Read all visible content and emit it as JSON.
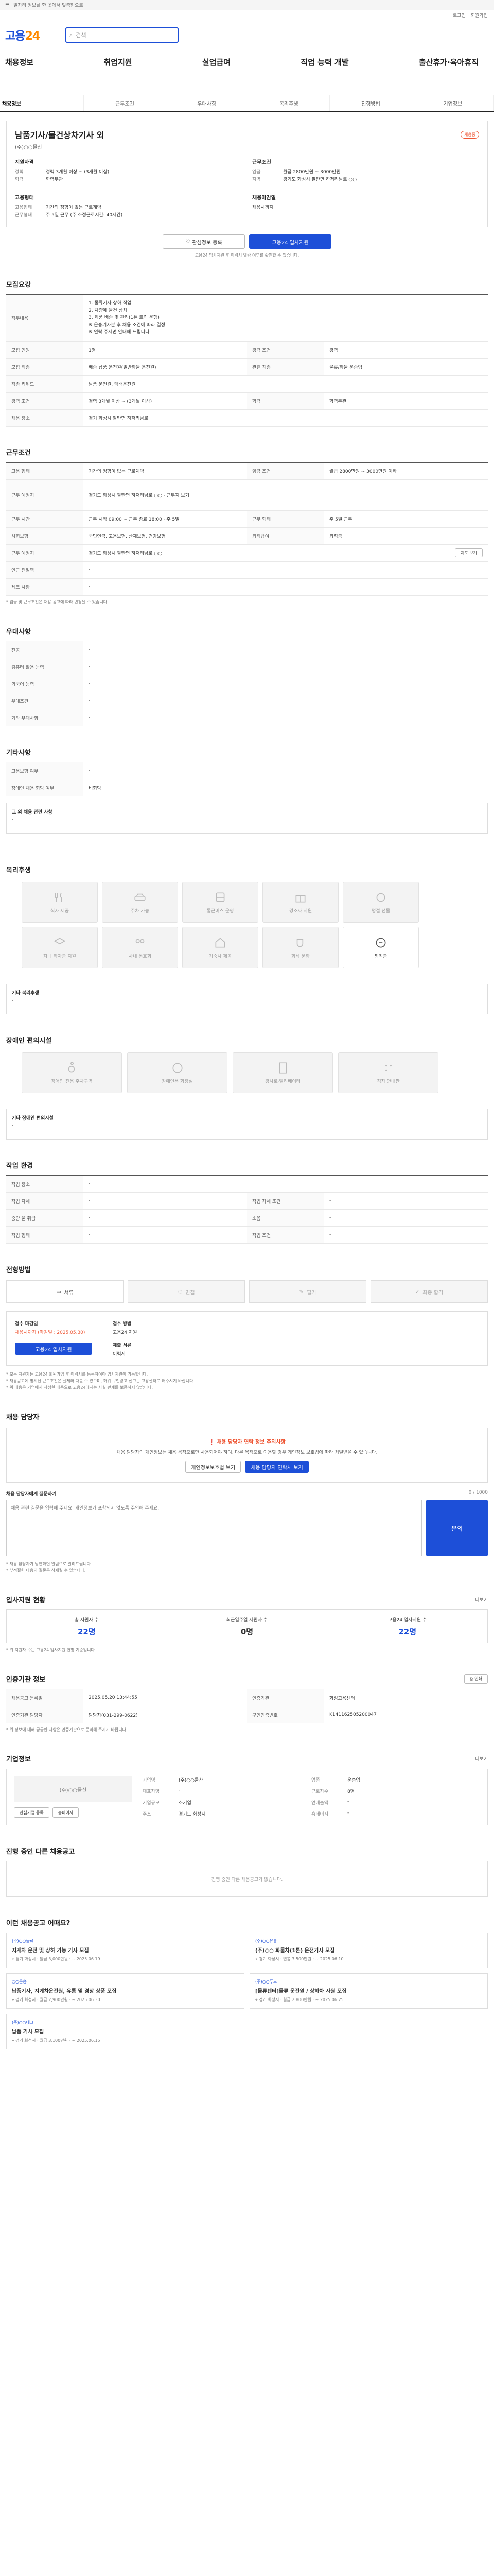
{
  "topbar": {
    "notice": "일자리 정보를 한 곳에서 맞춤형으로"
  },
  "util": {
    "login": "로그인",
    "join": "회원가입"
  },
  "header": {
    "logo_a": "고용",
    "logo_b": "24",
    "search_placeholder": "검색"
  },
  "gnb": [
    "채용정보",
    "취업지원",
    "실업급여",
    "직업 능력 개발",
    "출산휴가·육아휴직"
  ],
  "tabs": [
    "채용정보",
    "근무조건",
    "우대사항",
    "복리후생",
    "전형방법",
    "기업정보"
  ],
  "job": {
    "title": "남품기사/물건상차기사 외",
    "badge": "채용중",
    "company": "(주)○○물산",
    "req_title": "지원자격",
    "req": [
      {
        "k": "경력",
        "v": "경력 3개월 이상 ~ (3개월 이상)"
      },
      {
        "k": "학력",
        "v": "학력무관"
      }
    ],
    "cond_title": "근무조건",
    "cond": [
      {
        "k": "임금",
        "v": "월급 2800만원 ~ 3000만원"
      },
      {
        "k": "지역",
        "v": "경기도 화성시 팔탄면 하저리남로 ○○"
      }
    ],
    "type_title": "고용형태",
    "type": [
      {
        "k": "고용형태",
        "v": "기간의 정함이 없는 근로계약"
      },
      {
        "k": "근무형태",
        "v": "주 5일 근무 (주 소정근로시간: 40시간)"
      }
    ],
    "deadline_title": "채용마감일",
    "deadline": "채용시까지",
    "scrap_btn": "관심정보 등록",
    "apply_btn": "고용24 입사지원",
    "apply_note": "고용24 입사지원 후 이력서 열람 여부를 확인할 수 있습니다."
  },
  "recruit": {
    "h": "모집요강",
    "duty_k": "직무내용",
    "duties": [
      "1. 물류기사 상하 작업",
      "2. 차량에 물건 상차",
      "3. 제품 배송 및 관리(1톤 트럭 운행)",
      "",
      "※ 운송기사분 후 채용 조건에 따라 결정",
      "※ 연락 주시면 안내해 드립니다"
    ],
    "rows": [
      {
        "k": "모집 인원",
        "v": "1명",
        "k2": "경력 조건",
        "v2": "경력"
      },
      {
        "k": "모집 직종",
        "v": "배송 납품 운전원(일반화물 운전원)",
        "k2": "관련 직종",
        "v2": "물류/화물 운송업"
      },
      {
        "k": "직종 키워드",
        "v": "남품 운전원, 택배운전원",
        "k2": "",
        "v2": ""
      },
      {
        "k": "경력 조건",
        "v": "경력 3개월 이상 ~ (3개월 이상)",
        "k2": "학력",
        "v2": "학력무관"
      },
      {
        "k": "채용 장소",
        "v": "경기 화성시 팔탄면 하저리남로",
        "k2": "",
        "v2": ""
      }
    ]
  },
  "work": {
    "h": "근무조건",
    "rows": [
      {
        "k": "고용 형태",
        "v": "기간의 정함이 없는 근로계약",
        "k2": "임금 조건",
        "v2": "월급 2800만원 ~ 3000만원 이하"
      },
      {
        "k": "근무 예정지",
        "v": "경기도 화성시 팔탄면 하저리남로 ○○  · 근무지 보기",
        "k2": "",
        "v2": ""
      },
      {
        "k": "근무 시간",
        "v": "근무 시작 09:00 ~ 근무 종료 18:00 · 주 5일",
        "k2": "근무 형태",
        "v2": "주 5일 근무"
      },
      {
        "k": "사회보험",
        "v": "국민연금, 고용보험, 산재보험, 건강보험",
        "k2": "퇴직급여",
        "v2": "퇴직금"
      },
      {
        "k": "근무 예정지",
        "v": "경기도 화성시 팔탄면 하저리남로 ○○",
        "k2": "",
        "v2": ""
      },
      {
        "k": "인근 전철역",
        "v": "-",
        "k2": "",
        "v2": ""
      },
      {
        "k": "체크 사항",
        "v": "-",
        "k2": "",
        "v2": ""
      }
    ],
    "map_btn": "지도 보기",
    "note": "* 임금 및 근무조건은 채용 공고에 따라 변경될 수 있습니다."
  },
  "pref": {
    "h": "우대사항",
    "rows": [
      {
        "k": "전공",
        "v": "-"
      },
      {
        "k": "컴퓨터 활용 능력",
        "v": "-"
      },
      {
        "k": "외국어 능력",
        "v": "-"
      },
      {
        "k": "우대조건",
        "v": "-"
      },
      {
        "k": "기타 우대사항",
        "v": "-"
      }
    ]
  },
  "other": {
    "h": "기타사항",
    "rows": [
      {
        "k": "고용보험 여부",
        "v": "-"
      },
      {
        "k": "장애인 채용 희망 여부",
        "v": "비희망"
      }
    ],
    "extra_k": "그 외 채용 관련 사항",
    "extra_v": "-"
  },
  "welfare": {
    "h": "복리후생",
    "items": [
      "식사 제공",
      "주차 가능",
      "통근버스 운영",
      "경조사 지원",
      "명절 선물",
      "자녀 학자금 지원",
      "사내 동호회",
      "기숙사 제공",
      "회식 문화",
      "퇴직금"
    ],
    "etc_k": "기타 복리후생",
    "etc_v": "-"
  },
  "disabled": {
    "h": "장애인 편의시설",
    "items": [
      "장애인 전용 주차구역",
      "장애인용 화장실",
      "경사로·엘리베이터",
      "점자 안내판"
    ],
    "etc_k": "기타 장애인 편의시설",
    "etc_v": "-"
  },
  "workenv": {
    "h": "작업 환경",
    "rows": [
      {
        "k": "작업 장소",
        "v": "-",
        "k2": "",
        "v2": ""
      },
      {
        "k": "작업 자세",
        "v": "-",
        "k2": "작업 자세 조건",
        "v2": "-"
      },
      {
        "k": "중량 물 취급",
        "v": "-",
        "k2": "소음",
        "v2": "-"
      },
      {
        "k": "작업 형태",
        "v": "-",
        "k2": "작업 조건",
        "v2": "-"
      }
    ]
  },
  "process": {
    "h": "전형방법",
    "steps": [
      "서류",
      "면접",
      "필기",
      "최종 합격"
    ],
    "deadline_k": "접수 마감일",
    "deadline_v": "채용시까지 (마감일 : 2025.05.30)",
    "method_k": "접수 방법",
    "method_v": "고용24 지원",
    "docs_k": "제출 서류",
    "docs_v": "이력서",
    "apply_btn": "고용24 입사지원",
    "notes": [
      "* 모든 지원자는 고용24 회원가입 후 이력서를 등록하여야 입사지원이 가능합니다.",
      "* 채용공고에 명시된 근로조건은 실제와 다를 수 있으며, 허위 구인광고 신고는 고용센터로 해주시기 바랍니다.",
      "* 위 내용은 기업에서 작성한 내용으로 고용24에서는 사실 관계를 보증하지 않습니다."
    ]
  },
  "contact": {
    "h": "채용 담당자",
    "warn_title": "채용 담당자 연락 정보 주의사항",
    "warn_body": "채용 담당자의 개인정보는 채용 목적으로만 사용되어야 하며, 다른 목적으로 이용할 경우 개인정보 보호법에 따라 처벌받을 수 있습니다.",
    "btn1": "개인정보보호법 보기",
    "btn2": "채용 담당자 연락처 보기",
    "ask_k": "채용 담당자에게 질문하기",
    "ask_count": "0 / 1000",
    "ask_placeholder": "채용 관련 질문을 입력해 주세요. 개인정보가 포함되지 않도록 주의해 주세요.",
    "ask_btn": "문의",
    "notes": [
      "* 채용 담당자가 답변하면 알림으로 알려드립니다.",
      "* 부적절한 내용의 질문은 삭제될 수 있습니다."
    ]
  },
  "stats": {
    "h": "입사지원 현황",
    "more": "더보기",
    "items": [
      {
        "k": "총 지원자 수",
        "v": "22명"
      },
      {
        "k": "최근일주일 지원자 수",
        "v": "0명"
      },
      {
        "k": "고용24 입사지원 수",
        "v": "22명"
      }
    ],
    "note": "* 위 지원자 수는 고용24 입사지원 현황 기준입니다."
  },
  "info": {
    "h": "인증기관 정보",
    "rows": [
      {
        "k": "채용공고 등록일",
        "v": "2025.05.20 13:44:55",
        "k2": "인증기관",
        "v2": "화성고용센터"
      },
      {
        "k": "인증기관 담당자",
        "v": "담당자(031-299-0622)",
        "k2": "구인인증번호",
        "v2": "K141162505200047"
      }
    ],
    "print_btn": "인쇄",
    "note": "* 위 정보에 대해 궁금한 사항은 인증기관으로 문의해 주시기 바랍니다."
  },
  "company": {
    "h": "기업정보",
    "more": "더보기",
    "name": "(주)○○물산",
    "fields": [
      {
        "k": "기업명",
        "v": "(주)○○물산",
        "k2": "업종",
        "v2": "운송업"
      },
      {
        "k": "대표자명",
        "v": "-",
        "k2": "근로자수",
        "v2": "8명"
      },
      {
        "k": "기업규모",
        "v": "소기업",
        "k2": "연매출액",
        "v2": "-"
      },
      {
        "k": "주소",
        "v": "경기도 화성시",
        "k2": "홈페이지",
        "v2": "-"
      }
    ],
    "btn1": "관심기업 등록",
    "btn2": "홈페이지"
  },
  "related": {
    "h": "진행 중인 다른 채용공고",
    "empty": "진행 중인 다른 채용공고가 없습니다."
  },
  "rec": {
    "h": "이런 채용공고 어때요?",
    "cards": [
      {
        "company": "(주)○○물류",
        "title": "지게차 운전 및 상하 가능 기사 모집",
        "loc": "경기 화성시",
        "wage": "월급 3,000만원",
        "date": "~ 2025.06.19"
      },
      {
        "company": "(주)○○유통",
        "title": "(주)○○ 화물차(1톤) 운전기사 모집",
        "loc": "경기 화성시",
        "wage": "연봉 3,500만원",
        "date": "~ 2025.06.10"
      },
      {
        "company": "○○운송",
        "title": "납품기사, 지게차운전원, 유통 및 경상 상품 모집",
        "loc": "경기 화성시",
        "wage": "월급 2,900만원",
        "date": "~ 2025.06.30"
      },
      {
        "company": "(주)○○푸드",
        "title": "[물류센터]물류 운전원 / 상하차 사원 모집",
        "loc": "경기 화성시",
        "wage": "월급 2,800만원",
        "date": "~ 2025.06.25"
      },
      {
        "company": "(주)○○테크",
        "title": "납품 기사 모집",
        "loc": "경기 화성시",
        "wage": "월급 3,100만원",
        "date": "~ 2025.06.15"
      }
    ]
  }
}
